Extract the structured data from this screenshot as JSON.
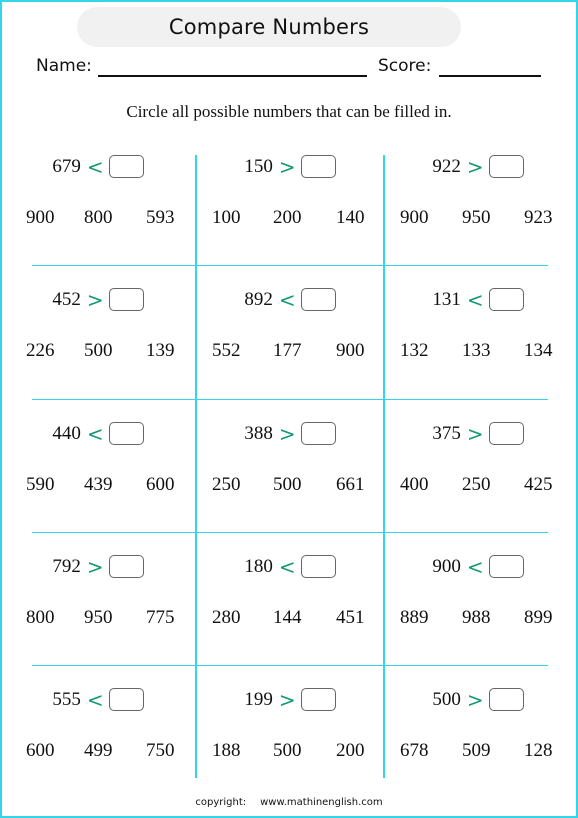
{
  "title": "Compare Numbers",
  "fields": {
    "name_label": "Name:",
    "score_label": "Score:"
  },
  "instruction": "Circle all possible numbers that  can be filled in.",
  "colors": {
    "border": "#33d6e8",
    "operator": "#119a73",
    "title_bg": "#f1f1f1"
  },
  "problems": [
    {
      "number": "679",
      "operator": "<",
      "options": [
        "900",
        "800",
        "593"
      ]
    },
    {
      "number": "150",
      "operator": ">",
      "options": [
        "100",
        "200",
        "140"
      ]
    },
    {
      "number": "922",
      "operator": ">",
      "options": [
        "900",
        "950",
        "923"
      ]
    },
    {
      "number": "452",
      "operator": ">",
      "options": [
        "226",
        "500",
        "139"
      ]
    },
    {
      "number": "892",
      "operator": "<",
      "options": [
        "552",
        "177",
        "900"
      ]
    },
    {
      "number": "131",
      "operator": "<",
      "options": [
        "132",
        "133",
        "134"
      ]
    },
    {
      "number": "440",
      "operator": "<",
      "options": [
        "590",
        "439",
        "600"
      ]
    },
    {
      "number": "388",
      "operator": ">",
      "options": [
        "250",
        "500",
        "661"
      ]
    },
    {
      "number": "375",
      "operator": ">",
      "options": [
        "400",
        "250",
        "425"
      ]
    },
    {
      "number": "792",
      "operator": ">",
      "options": [
        "800",
        "950",
        "775"
      ]
    },
    {
      "number": "180",
      "operator": "<",
      "options": [
        "280",
        "144",
        "451"
      ]
    },
    {
      "number": "900",
      "operator": "<",
      "options": [
        "889",
        "988",
        "899"
      ]
    },
    {
      "number": "555",
      "operator": "<",
      "options": [
        "600",
        "499",
        "750"
      ]
    },
    {
      "number": "199",
      "operator": ">",
      "options": [
        "188",
        "500",
        "200"
      ]
    },
    {
      "number": "500",
      "operator": ">",
      "options": [
        "678",
        "509",
        "128"
      ]
    }
  ],
  "footer": {
    "label": "copyright:",
    "site": "www.mathinenglish.com"
  }
}
